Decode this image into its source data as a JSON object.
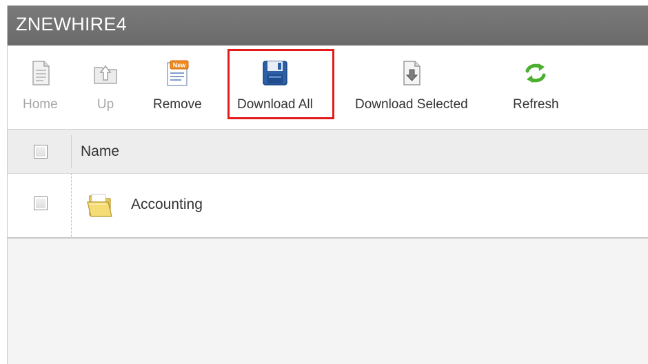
{
  "window": {
    "title": "ZNEWHIRE4"
  },
  "toolbar": {
    "items": [
      {
        "label": "Home",
        "icon": "home-document-icon",
        "enabled": false
      },
      {
        "label": "Up",
        "icon": "up-folder-icon",
        "enabled": false
      },
      {
        "label": "Remove",
        "icon": "remove-new-document-icon",
        "enabled": true
      },
      {
        "label": "Download All",
        "icon": "floppy-disk-icon",
        "enabled": true,
        "highlighted": true
      },
      {
        "label": "Download Selected",
        "icon": "download-document-icon",
        "enabled": true
      },
      {
        "label": "Refresh",
        "icon": "refresh-arrows-icon",
        "enabled": true
      }
    ],
    "badge_text": "New"
  },
  "grid": {
    "columns": [
      "Name"
    ],
    "rows": [
      {
        "name": "Accounting",
        "type": "folder",
        "checked": false
      }
    ],
    "header_checked": false
  },
  "colors": {
    "title_bar": "#6f6f6f",
    "highlight": "#e31b1b",
    "floppy_blue": "#2b5fa6",
    "refresh_green": "#4caf2e"
  }
}
